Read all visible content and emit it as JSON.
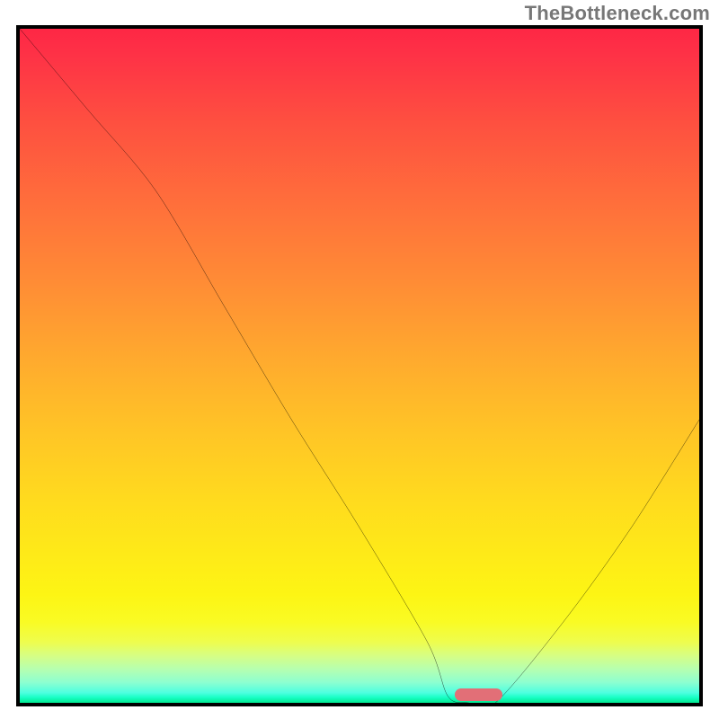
{
  "attribution": "TheBottleneck.com",
  "chart_data": {
    "type": "line",
    "title": "",
    "xlabel": "",
    "ylabel": "",
    "xlim": [
      0,
      100
    ],
    "ylim": [
      0,
      100
    ],
    "grid": false,
    "series": [
      {
        "name": "bottleneck-curve",
        "x": [
          0,
          10,
          20,
          30,
          40,
          50,
          60,
          63,
          66,
          70,
          80,
          90,
          100
        ],
        "y": [
          100,
          88,
          76,
          59,
          42,
          26,
          9,
          1,
          0,
          0,
          12,
          26,
          42
        ]
      }
    ],
    "background_gradient": {
      "top": "#fe2745",
      "middle": "#ffdb1e",
      "bottom": "#00e88f"
    },
    "optimal_marker": {
      "x_start": 64,
      "x_end": 71,
      "y": 0
    }
  }
}
